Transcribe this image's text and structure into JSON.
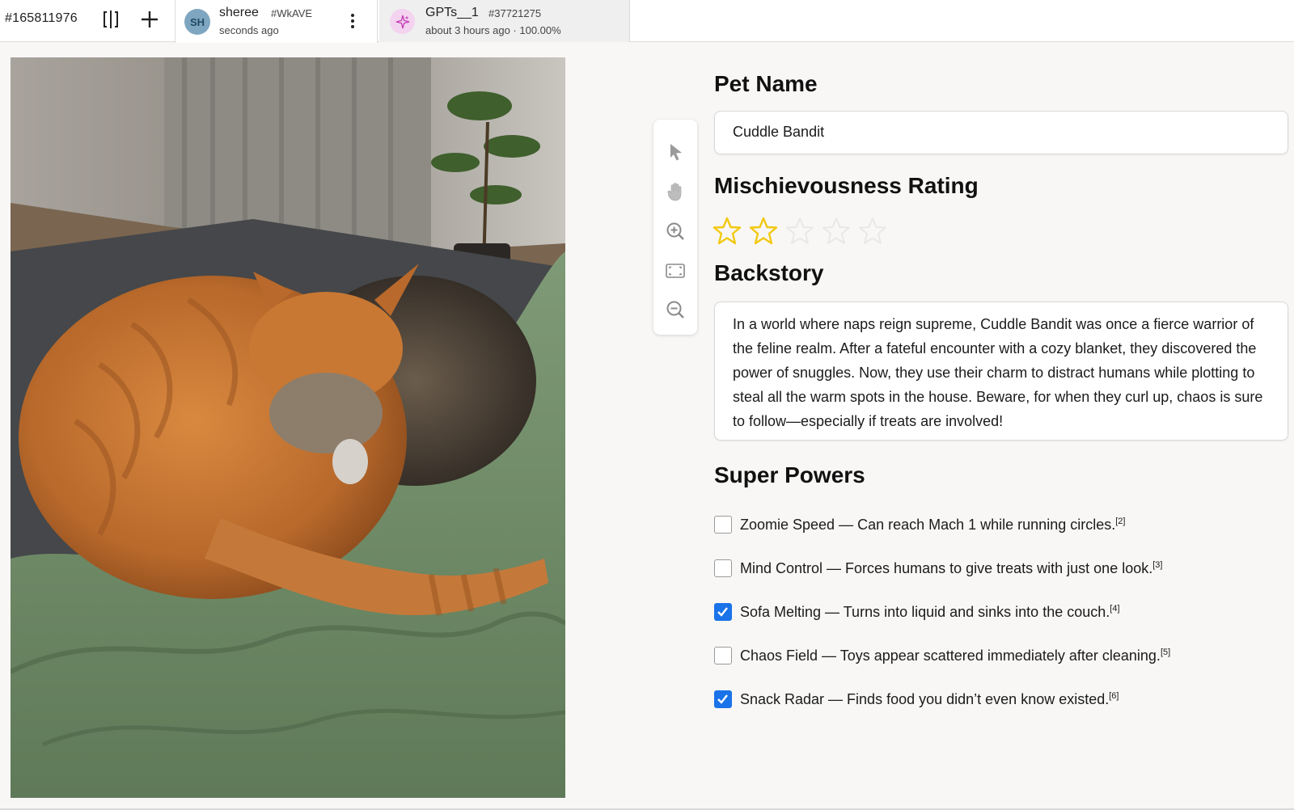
{
  "header": {
    "task_id": "#165811976",
    "tabs": [
      {
        "avatar_initials": "SH",
        "name": "sheree",
        "code": "#WkAVE",
        "subtitle": "seconds ago"
      },
      {
        "name": "GPTs__1",
        "code": "#37721275",
        "subtitle": "about 3 hours ago · 100.00%"
      }
    ]
  },
  "toolbar": {
    "tools": [
      "pointer-icon",
      "hand-icon",
      "zoom-in-icon",
      "fit-screen-icon",
      "zoom-out-icon"
    ]
  },
  "form": {
    "pet_name_label": "Pet Name",
    "pet_name_value": "Cuddle Bandit",
    "rating_label": "Mischievousness Rating",
    "rating": {
      "value": 2,
      "max": 5,
      "color": "#f2c811"
    },
    "backstory_label": "Backstory",
    "backstory_text": "In a world where naps reign supreme, Cuddle Bandit was once a fierce warrior of the feline realm. After a fateful encounter with a cozy blanket, they discovered the power of snuggles. Now, they use their charm to distract humans while plotting to steal all the warm spots in the house. Beware, for when they curl up, chaos is sure to follow—especially if treats are involved!",
    "powers_label": "Super Powers",
    "powers": [
      {
        "label": "Zoomie Speed — Can reach Mach 1 while running circles.",
        "ref": "[2]",
        "checked": false
      },
      {
        "label": "Mind Control — Forces humans to give treats with just one look.",
        "ref": "[3]",
        "checked": false
      },
      {
        "label": "Sofa Melting — Turns into liquid and sinks into the couch.",
        "ref": "[4]",
        "checked": true
      },
      {
        "label": "Chaos Field — Toys appear scattered immediately after cleaning.",
        "ref": "[5]",
        "checked": false
      },
      {
        "label": "Snack Radar — Finds food you didn’t even know existed.",
        "ref": "[6]",
        "checked": true
      }
    ],
    "checkbox_color": "#1a73e8"
  }
}
